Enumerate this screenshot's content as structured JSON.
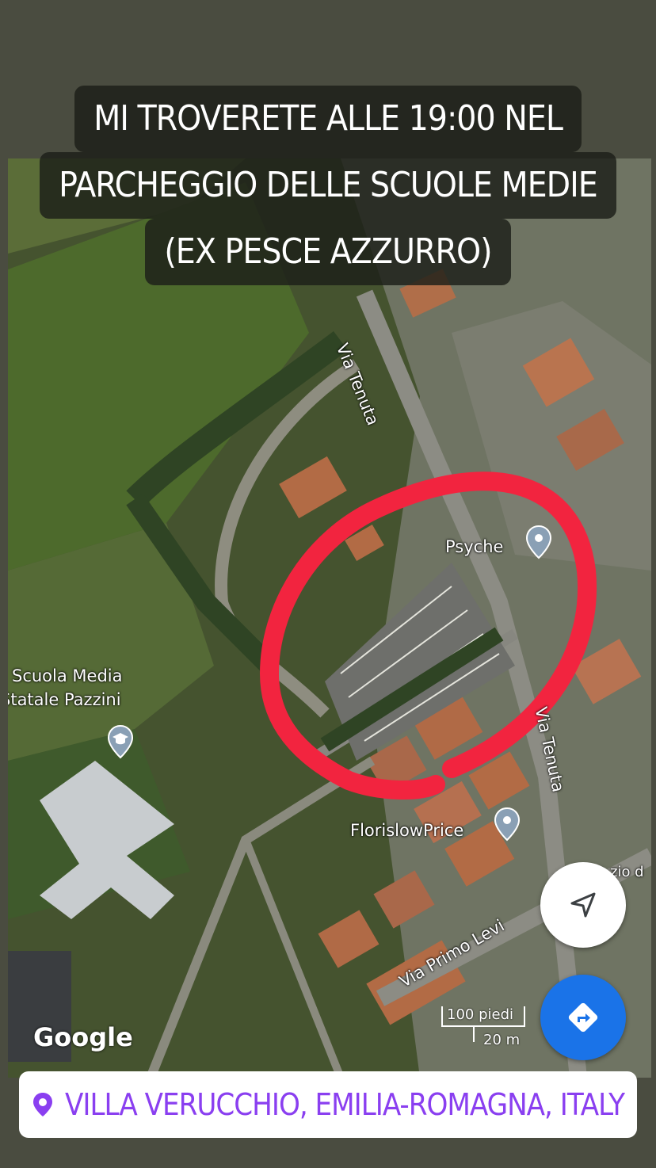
{
  "caption": {
    "lines": [
      "MI TROVERETE ALLE 19:00 NEL",
      "PARCHEGGIO DELLE SCUOLE MEDIE",
      "(EX PESCE AZZURRO)"
    ]
  },
  "map": {
    "street_labels": [
      "Via Tenuta",
      "Via Tenuta",
      "Via Primo Levi"
    ],
    "places": [
      "Psyche",
      "FlorislowPrice"
    ],
    "school_label": [
      "Scuola Media",
      "Statale Pazzini"
    ],
    "edge_label": "zio d",
    "attribution": "Google",
    "scale": {
      "feet": "100 piedi",
      "meters": "20 m"
    },
    "highlight_color": "#f2243f",
    "icons": [
      "map-pin-icon",
      "school-pin-icon",
      "navigation-arrow-icon",
      "directions-icon",
      "location-pin-icon"
    ]
  },
  "location_sticker": {
    "text": "VILLA VERUCCHIO, EMILIA-ROMAGNA, ITALY",
    "color": "#8a3ff0"
  }
}
